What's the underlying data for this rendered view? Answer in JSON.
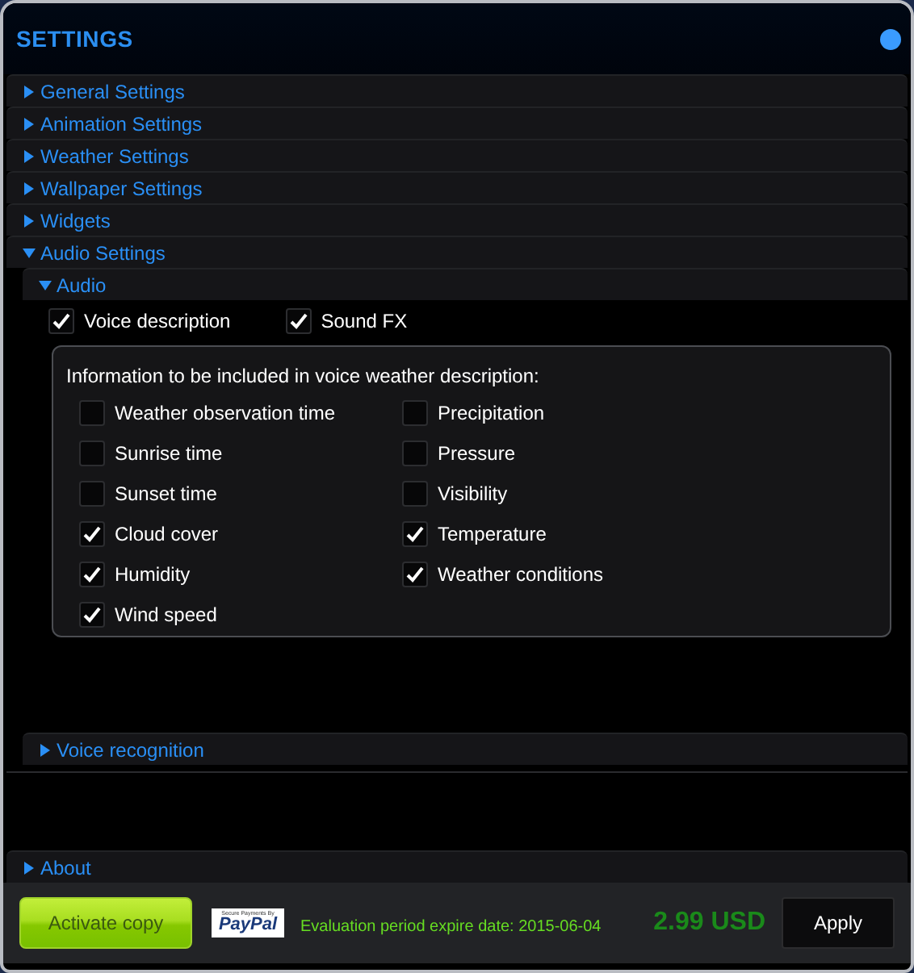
{
  "window": {
    "title": "SETTINGS"
  },
  "sections": [
    {
      "label": "General Settings",
      "expanded": false
    },
    {
      "label": "Animation Settings",
      "expanded": false
    },
    {
      "label": "Weather Settings",
      "expanded": false
    },
    {
      "label": "Wallpaper Settings",
      "expanded": false
    },
    {
      "label": "Widgets",
      "expanded": false
    },
    {
      "label": "Audio Settings",
      "expanded": true,
      "subsections": [
        {
          "label": "Audio",
          "expanded": true,
          "options": [
            {
              "label": "Voice description",
              "checked": true
            },
            {
              "label": "Sound FX",
              "checked": true
            }
          ],
          "info_group": {
            "title": "Information to be included in voice weather description:",
            "items": [
              {
                "label": "Weather observation time",
                "checked": false
              },
              {
                "label": "Precipitation",
                "checked": false
              },
              {
                "label": "Sunrise time",
                "checked": false
              },
              {
                "label": "Pressure",
                "checked": false
              },
              {
                "label": "Sunset time",
                "checked": false
              },
              {
                "label": "Visibility",
                "checked": false
              },
              {
                "label": "Cloud cover",
                "checked": true
              },
              {
                "label": "Temperature",
                "checked": true
              },
              {
                "label": "Humidity",
                "checked": true
              },
              {
                "label": "Weather conditions",
                "checked": true
              },
              {
                "label": "Wind speed",
                "checked": true
              }
            ]
          }
        },
        {
          "label": "Voice recognition",
          "expanded": false
        }
      ]
    },
    {
      "label": "About",
      "expanded": false
    }
  ],
  "footer": {
    "activate_button": "Activate copy",
    "paypal_badge": {
      "caption": "Secure Payments By",
      "brand": "PayPal"
    },
    "evaluation_text": "Evaluation period expire date: 2015-06-04",
    "price": "2.99 USD",
    "apply_button": "Apply"
  }
}
